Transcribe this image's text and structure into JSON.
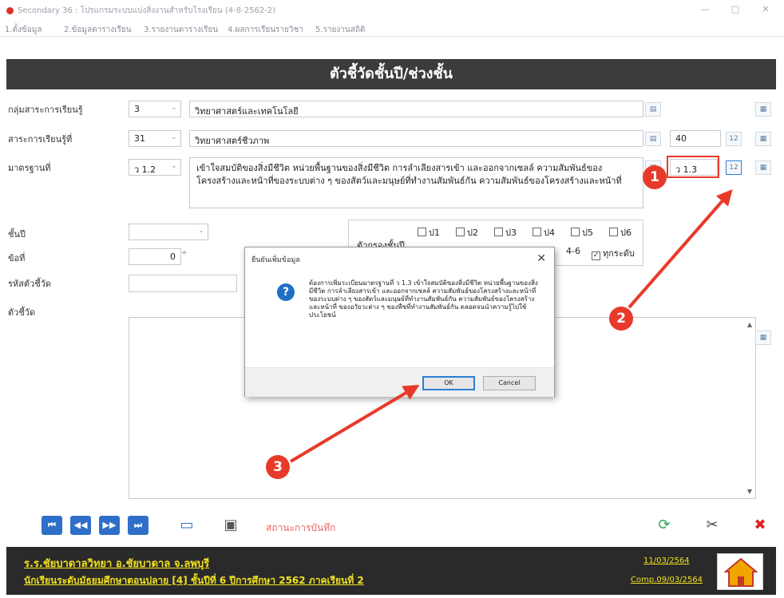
{
  "window": {
    "title": "Secondary 36 : โปรแกรมระบบแบ่งสิ่งงานสำหรับโรงเรียน (4-8-2562-2)",
    "controls": [
      "—",
      "□",
      "✕"
    ]
  },
  "menu": {
    "items": [
      "1.ตั้งข้อมูล",
      "2.ข้อมูลตารางเรียน",
      "3.รายงานตารางเรียน",
      "4.ผลการเรียนรายวิชา",
      "5.รายงานสถิติ"
    ]
  },
  "header": {
    "title": "ตัวชี้วัดชั้นปี/ช่วงชั้น"
  },
  "form": {
    "group_label": "กลุ่มสาระการเรียนรู้",
    "group_code": "3",
    "group_name": "วิทยาศาสตร์และเทคโนโลยี",
    "strand_label": "สาระการเรียนรู้ที่",
    "strand_code": "31",
    "strand_name": "วิทยาศาสตร์ชีวภาพ",
    "strand_count": "40",
    "standard_label": "มาตรฐานที่",
    "standard_code": "ว 1.2",
    "standard_text": "เข้าใจสมบัติของสิ่งมีชีวิต หน่วยพื้นฐานของสิ่งมีชีวิต การลำเลียงสารเข้า และออกจากเซลล์ ความสัมพันธ์ของโครงสร้างและหน้าที่ของระบบต่าง ๆ ของสัตว์และมนุษย์ที่ทำงานสัมพันธ์กัน ความสัมพันธ์ของโครงสร้างและหน้าที่",
    "standard_new_code": "ว 1.3",
    "grade_label": "ชั้นปี",
    "grade_value": "",
    "order_label": "ข้อที่",
    "order_value": "0",
    "indicator_code_label": "รหัสตัวชี้วัด",
    "indicator_code_value": "",
    "indicator_label": "ตัวชี้วัด",
    "btn_sort": "12"
  },
  "grades_box": {
    "label": "ตัวกรองชั้นปี",
    "row1": [
      "ป1",
      "ป2",
      "ป3",
      "ป4",
      "ป5",
      "ป6"
    ],
    "row2_tail": "4-6",
    "all_label": "ทุกระดับ"
  },
  "dialog": {
    "title": "ยืนยันเพิ่มข้อมูล",
    "message": "ต้องการเพิ่มระเบียนมาตรฐานที่ ว 1.3 เข้าใจสมบัติของสิ่งมีชีวิต หน่วยพื้นฐานของสิ่งมีชีวิต การลำเลียงสารเข้า และออกจากเซลล์ ความสัมพันธ์ของโครงสร้างและหน้าที่ของระบบต่าง ๆ ของสัตว์และมนุษย์ที่ทำงานสัมพันธ์กัน ความสัมพันธ์ของโครงสร้างและหน้าที่ ของอวัยวะต่าง ๆ ของพืชที่ทำงานสัมพันธ์กัน ตลอดจนนำความรู้ไปใช้ประโยชน์",
    "ok_label": "OK",
    "cancel_label": "Cancel"
  },
  "toolbar": {
    "status": "สถานะการบันทึก"
  },
  "footer": {
    "school": "ร.ร.ชัยบาดาลวิทยา  อ.ชัยบาดาล  จ.ลพบุรี",
    "level": "นักเรียนระดับมัธยมศึกษาตอนปลาย [4]  ชั้นปีที่ 6  ปีการศึกษา 2562  ภาคเรียนที่  2",
    "date": "11/03/2564",
    "comp": "Comp.09/03/2564"
  },
  "annotations": {
    "a1": "1",
    "a2": "2",
    "a3": "3"
  },
  "colors": {
    "accent_red": "#e83a2a",
    "header_dark": "#3c3c3c",
    "footer_yellow": "#f0e020",
    "nav_blue": "#2f6fc9"
  }
}
